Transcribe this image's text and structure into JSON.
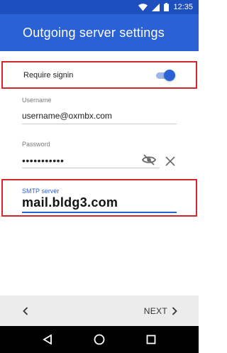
{
  "status_bar": {
    "time": "12:35",
    "icons": [
      "wifi-icon",
      "signal-icon",
      "battery-icon"
    ]
  },
  "app_bar": {
    "title": "Outgoing server settings",
    "color": "#2a62d6"
  },
  "form": {
    "require_signin": {
      "label": "Require signin",
      "enabled": true
    },
    "username": {
      "label": "Username",
      "value": "username@oxmbx.com"
    },
    "password": {
      "label": "Password",
      "value": "•••••••••••"
    },
    "smtp_server": {
      "label": "SMTP server",
      "value": "mail.bldg3.com"
    }
  },
  "footer": {
    "next_label": "NEXT"
  },
  "colors": {
    "accent": "#2a62d6",
    "highlight_border": "#d4282d"
  }
}
